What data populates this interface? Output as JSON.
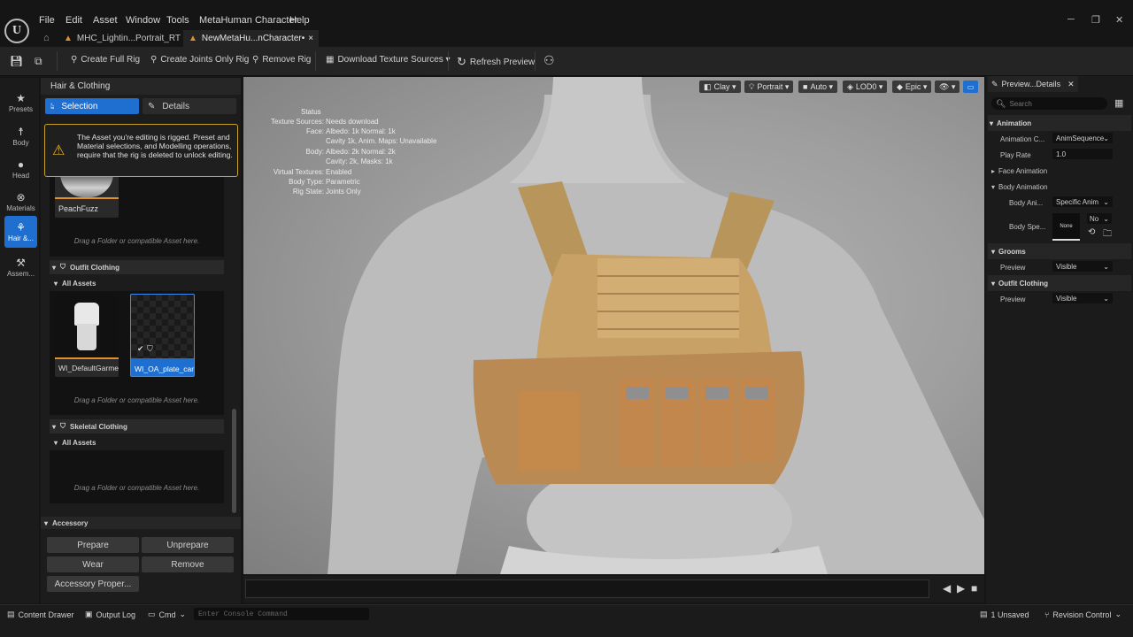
{
  "menubar": {
    "logo": "U",
    "items": [
      "File",
      "Edit",
      "Asset",
      "Window",
      "Tools",
      "MetaHuman Character",
      "Help"
    ],
    "window_controls": [
      "─",
      "❐",
      "✕"
    ]
  },
  "tabs": [
    {
      "label": "MHC_Lightin...Portrait_RT"
    },
    {
      "label": "NewMetaHu...nCharacter•",
      "close": "×"
    }
  ],
  "toolbar": {
    "create_full_rig": "Create Full Rig",
    "create_joints_only_rig": "Create Joints Only Rig",
    "remove_rig": "Remove Rig",
    "download_texture_sources": "Download Texture Sources ▾",
    "refresh_preview": "Refresh Preview"
  },
  "left_nav": [
    {
      "label": "Presets",
      "icon": "star-icon"
    },
    {
      "label": "Body",
      "icon": "body-icon"
    },
    {
      "label": "Head",
      "icon": "head-icon"
    },
    {
      "label": "Materials",
      "icon": "materials-icon"
    },
    {
      "label": "Hair &...",
      "icon": "hair-icon",
      "active": true
    },
    {
      "label": "Assem...",
      "icon": "assembly-icon"
    }
  ],
  "left_panel": {
    "title": "Hair & Clothing",
    "selection_tab": "Selection",
    "details_tab": "Details",
    "warning_text": "The Asset you're editing is rigged. Preset and Material selections, and Modelling operations, require that the rig is deleted to unlock editing.",
    "peach_fuzz_label": "PeachFuzz",
    "drop_hint_1": "Drag a Folder or compatible Asset here.",
    "outfit_section": "Outfit Clothing",
    "all_assets_1": "All Assets",
    "asset1_label": "WI_DefaultGarment",
    "asset2_label": "WI_OA_plate_carr...",
    "drop_hint_2": "Drag a Folder or compatible Asset here.",
    "skeletal_section": "Skeletal Clothing",
    "all_assets_2": "All Assets",
    "drop_hint_3": "Drag a Folder or compatible Asset here.",
    "accessory_section": "Accessory",
    "prepare": "Prepare",
    "unprepare": "Unprepare",
    "wear": "Wear",
    "remove": "Remove",
    "accessory_properties": "Accessory Proper..."
  },
  "viewport": {
    "tools": {
      "clay": "Clay ▾",
      "portrait": "Portrait ▾",
      "auto": "Auto ▾",
      "lod": "LOD0 ▾",
      "quality": "Epic ▾",
      "view": "👁 ▾"
    },
    "status": {
      "title": "Status",
      "rows": [
        {
          "label": "Texture Sources:",
          "value": "Needs download"
        },
        {
          "label": "Face:",
          "value": "Albedo: 1k Normal: 1k"
        },
        {
          "label": "",
          "value": "Cavity 1k, Anim. Maps: Unavailable"
        },
        {
          "label": "Body:",
          "value": "Albedo: 2k Normal: 2k"
        },
        {
          "label": "",
          "value": "Cavity: 2k, Masks: 1k"
        },
        {
          "label": "Virtual Textures:",
          "value": "Enabled"
        },
        {
          "label": "Body Type:",
          "value": "Parametric"
        },
        {
          "label": "Rig State:",
          "value": "Joints Only"
        }
      ]
    }
  },
  "details": {
    "tab_label": "Preview...Details",
    "search_placeholder": "Search",
    "animation_section": "Animation",
    "animation_class_label": "Animation C...",
    "animation_class_value": "AnimSequence",
    "play_rate_label": "Play Rate",
    "play_rate_value": "1.0",
    "face_animation": "Face Animation",
    "body_animation": "Body Animation",
    "body_anim_label": "Body Ani...",
    "body_anim_value": "Specific Anim",
    "body_spec_label": "Body Spe...",
    "body_spec_thumb": "None",
    "body_spec_dropdown": "No",
    "grooms_section": "Grooms",
    "grooms_preview_label": "Preview",
    "grooms_preview_value": "Visible",
    "outfit_section": "Outfit Clothing",
    "outfit_preview_label": "Preview",
    "outfit_preview_value": "Visible"
  },
  "statusbar": {
    "content_drawer": "Content Drawer",
    "output_log": "Output Log",
    "cmd": "Cmd",
    "console_placeholder": "Enter Console Command",
    "unsaved": "1 Unsaved",
    "revision_control": "Revision Control"
  },
  "colors": {
    "accent": "#1f6fd1",
    "warning_border": "#c9a227",
    "vest": "#c8a167"
  }
}
